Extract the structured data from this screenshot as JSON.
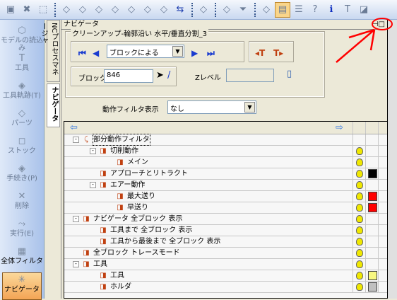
{
  "toolbar": {
    "icons": [
      "view-icon",
      "select-clear-icon",
      "box-select-icon",
      "sep",
      "op1-icon",
      "op2-icon",
      "op3-icon",
      "op4-icon",
      "op5-icon",
      "op6-icon",
      "op7-icon",
      "list-swap-icon",
      "sep",
      "edit-icon",
      "sep",
      "tool-path-icon",
      "filter-icon",
      "sep",
      "model-icon",
      "navigator-icon",
      "list-icon",
      "help-icon",
      "info-icon",
      "tool-holder-icon",
      "layout-icon"
    ]
  },
  "sidebar": {
    "items": [
      {
        "label": "モデルの読込み",
        "icon": "model-load-icon"
      },
      {
        "label": "工具",
        "icon": "tool-icon"
      },
      {
        "label": "工具軌跡(T)",
        "icon": "toolpath-icon"
      },
      {
        "label": "パーツ",
        "icon": "parts-icon"
      },
      {
        "label": "ストック",
        "icon": "stock-icon"
      },
      {
        "label": "手続き(P)",
        "icon": "procedure-icon"
      },
      {
        "label": "削除",
        "icon": "delete-icon"
      },
      {
        "label": "実行(E)",
        "icon": "run-icon"
      },
      {
        "label": "全体フィルタ",
        "icon": "filter-icon"
      },
      {
        "label": "ナビゲータ",
        "icon": "navigator-icon"
      }
    ]
  },
  "vtabs": [
    "NCプロセスマネージャ",
    "ナビゲータ"
  ],
  "panel": {
    "title": "ナビゲータ",
    "group_title": "クリーンアップ-輪郭沿い 水平/垂直分割_3",
    "mode": "ブロックによる",
    "block_label": "ブロック",
    "block_value": "846",
    "z_label": "Zレベル",
    "z_value": "",
    "filter_label": "動作フィルタ表示",
    "filter_value": "なし"
  },
  "tree": {
    "rows": [
      {
        "label": "部分動作フィルタ",
        "level": 0,
        "expand": "-",
        "bulb": false,
        "color": null
      },
      {
        "label": "切削動作",
        "level": 1,
        "expand": "-",
        "bulb": true,
        "color": null
      },
      {
        "label": "メイン",
        "level": 2,
        "expand": "",
        "bulb": true,
        "color": null
      },
      {
        "label": "アプローチとリトラクト",
        "level": 1,
        "expand": "",
        "bulb": true,
        "color": "#000000"
      },
      {
        "label": "エアー動作",
        "level": 1,
        "expand": "-",
        "bulb": true,
        "color": null
      },
      {
        "label": "最大送り",
        "level": 2,
        "expand": "",
        "bulb": true,
        "color": "#ff0000"
      },
      {
        "label": "早送り",
        "level": 2,
        "expand": "",
        "bulb": true,
        "color": "#ff0000"
      },
      {
        "label": "ナビゲータ 全ブロック 表示",
        "level": 0,
        "expand": "-",
        "bulb": true,
        "color": null
      },
      {
        "label": "工具まで 全ブロック 表示",
        "level": 1,
        "expand": "",
        "bulb": true,
        "color": null
      },
      {
        "label": "工具から最後まで 全ブロック 表示",
        "level": 1,
        "expand": "",
        "bulb": true,
        "color": null
      },
      {
        "label": "全ブロック トレースモード",
        "level": 0,
        "expand": "",
        "bulb": true,
        "color": null
      },
      {
        "label": "工具",
        "level": 0,
        "expand": "-",
        "bulb": true,
        "color": null
      },
      {
        "label": "工具",
        "level": 1,
        "expand": "",
        "bulb": true,
        "color": "#f8f880"
      },
      {
        "label": "ホルダ",
        "level": 1,
        "expand": "",
        "bulb": true,
        "color": "#c0c0c0"
      }
    ]
  }
}
